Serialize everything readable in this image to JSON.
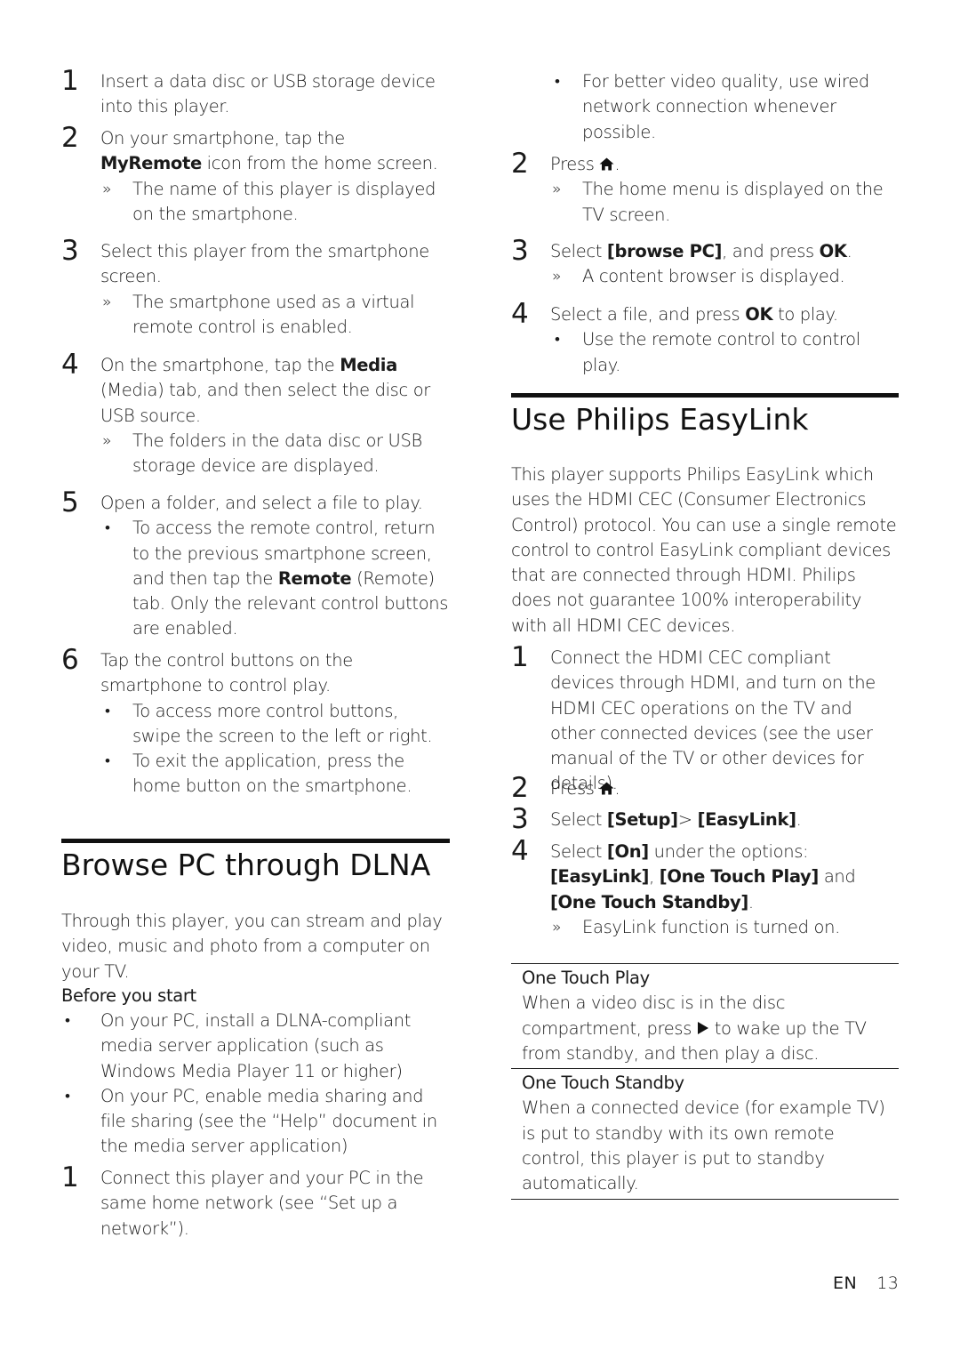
{
  "left_column": {
    "steps_intro": [
      {
        "num": "1",
        "text": "Insert a data disc or USB storage device into this player."
      },
      {
        "num": "2",
        "text_pre": "On your smartphone, tap the ",
        "bold": "MyRemote",
        "text_post": " icon from the home screen.",
        "result": "The name of this player is displayed on the smartphone."
      },
      {
        "num": "3",
        "text": "Select this player from the smartphone screen.",
        "result": "The smartphone used as a virtual remote control is enabled."
      },
      {
        "num": "4",
        "text_pre": "On the smartphone, tap the ",
        "bold": "Media",
        "text_post": " (Media) tab, and then select the disc or USB source.",
        "result": "The folders in the data disc or USB storage device are displayed."
      },
      {
        "num": "5",
        "text": "Open a folder, and select a file to play.",
        "note_pre": "To access the remote control, return to the previous smartphone screen, and then tap the ",
        "note_bold": "Remote",
        "note_post": " (Remote) tab. Only the relevant control buttons are enabled."
      },
      {
        "num": "6",
        "text": "Tap the control buttons on the smartphone to control play.",
        "notes": [
          "To access more control buttons, swipe the screen to the left or right.",
          "To exit the application, press the home button on the smartphone."
        ]
      }
    ],
    "section_dlna": {
      "title": "Browse PC through DLNA",
      "intro": "Through this player, you can stream and play video, music and photo from a computer on your TV.",
      "before_label": "Before you start",
      "prereqs": [
        "On your PC, install a DLNA-compliant media server application (such as Windows Media Player 11 or higher)",
        "On your PC, enable media sharing and file sharing (see the “Help” document in the media server application)"
      ],
      "step1": {
        "num": "1",
        "text": "Connect this player and your PC in the same home network (see “Set up a network”)."
      }
    }
  },
  "right_column": {
    "dlna_cont": {
      "note": "For better video quality, use wired network connection whenever possible.",
      "step2": {
        "num": "2",
        "text_pre": "Press ",
        "icon": "home-icon",
        "text_post": ".",
        "result": "The home menu is displayed on the TV screen."
      },
      "step3": {
        "num": "3",
        "text_pre": "Select ",
        "bold1": "[browse PC]",
        "text_mid": ", and press ",
        "bold2": "OK",
        "text_post": ".",
        "result": "A content browser is displayed."
      },
      "step4": {
        "num": "4",
        "text_pre": "Select a file, and press ",
        "bold": "OK",
        "text_post": " to play.",
        "note": "Use the remote control to control play."
      }
    },
    "section_easylink": {
      "title": "Use Philips EasyLink",
      "intro": "This player supports Philips EasyLink which uses the HDMI CEC (Consumer Electronics Control) protocol. You can use a single remote control to control EasyLink compliant devices that are connected through HDMI. Philips does not guarantee 100% interoperability with all HDMI CEC devices.",
      "step1": {
        "num": "1",
        "text": "Connect the HDMI CEC compliant devices through HDMI, and turn on the HDMI CEC operations on the TV and other connected devices (see the user manual of the TV or other devices for details)."
      },
      "step2": {
        "num": "2",
        "text_pre": "Press ",
        "icon": "home-icon",
        "text_post": "."
      },
      "step3": {
        "num": "3",
        "text_pre": "Select ",
        "bold1": "[Setup]",
        "text_mid": "> ",
        "bold2": "[EasyLink]",
        "text_post": "."
      },
      "step4": {
        "num": "4",
        "text_pre": "Select ",
        "bold1": "[On]",
        "text_mid1": " under the options: ",
        "bold2": "[EasyLink]",
        "text_mid2": ", ",
        "bold3": "[One Touch Play]",
        "text_mid3": " and ",
        "bold4": "[One Touch Standby]",
        "text_post": ".",
        "result": "EasyLink function is turned on."
      },
      "table": [
        {
          "title": "One Touch Play",
          "desc_pre": "When a video disc is in the disc compartment, press ",
          "icon": "play-icon",
          "desc_post": " to wake up the TV from standby, and then play a disc."
        },
        {
          "title": "One Touch Standby",
          "desc": "When a connected device (for example TV) is put to standby with its own remote control, this player is put to standby automatically."
        }
      ]
    }
  },
  "footer": {
    "lang": "EN",
    "page": "13"
  },
  "marks": {
    "result": "»",
    "bullet": "•"
  }
}
